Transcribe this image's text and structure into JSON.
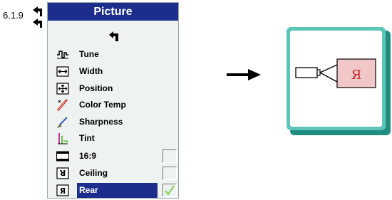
{
  "section_number": "6.1.9",
  "menu": {
    "title": "Picture",
    "items": [
      {
        "label": "Tune",
        "icon": "tune-icon"
      },
      {
        "label": "Width",
        "icon": "width-icon"
      },
      {
        "label": "Position",
        "icon": "position-icon"
      },
      {
        "label": "Color Temp",
        "icon": "color-temp-icon"
      },
      {
        "label": "Sharpness",
        "icon": "sharpness-icon"
      },
      {
        "label": "Tint",
        "icon": "tint-icon"
      },
      {
        "label": "16:9",
        "icon": "aspect-16-9-icon",
        "checked": false
      },
      {
        "label": "Ceiling",
        "icon": "ceiling-icon",
        "checked": false
      },
      {
        "label": "Rear",
        "icon": "rear-icon",
        "checked": true,
        "selected": true
      }
    ]
  },
  "illustration": {
    "screen_glyph": "Я"
  },
  "colors": {
    "menu_title_bg": "#1d2d8e",
    "menu_bg": "#eef3f1",
    "frame_teal": "#2aa89a",
    "check_green": "#8ccc66",
    "screen_red": "#c8262a"
  }
}
